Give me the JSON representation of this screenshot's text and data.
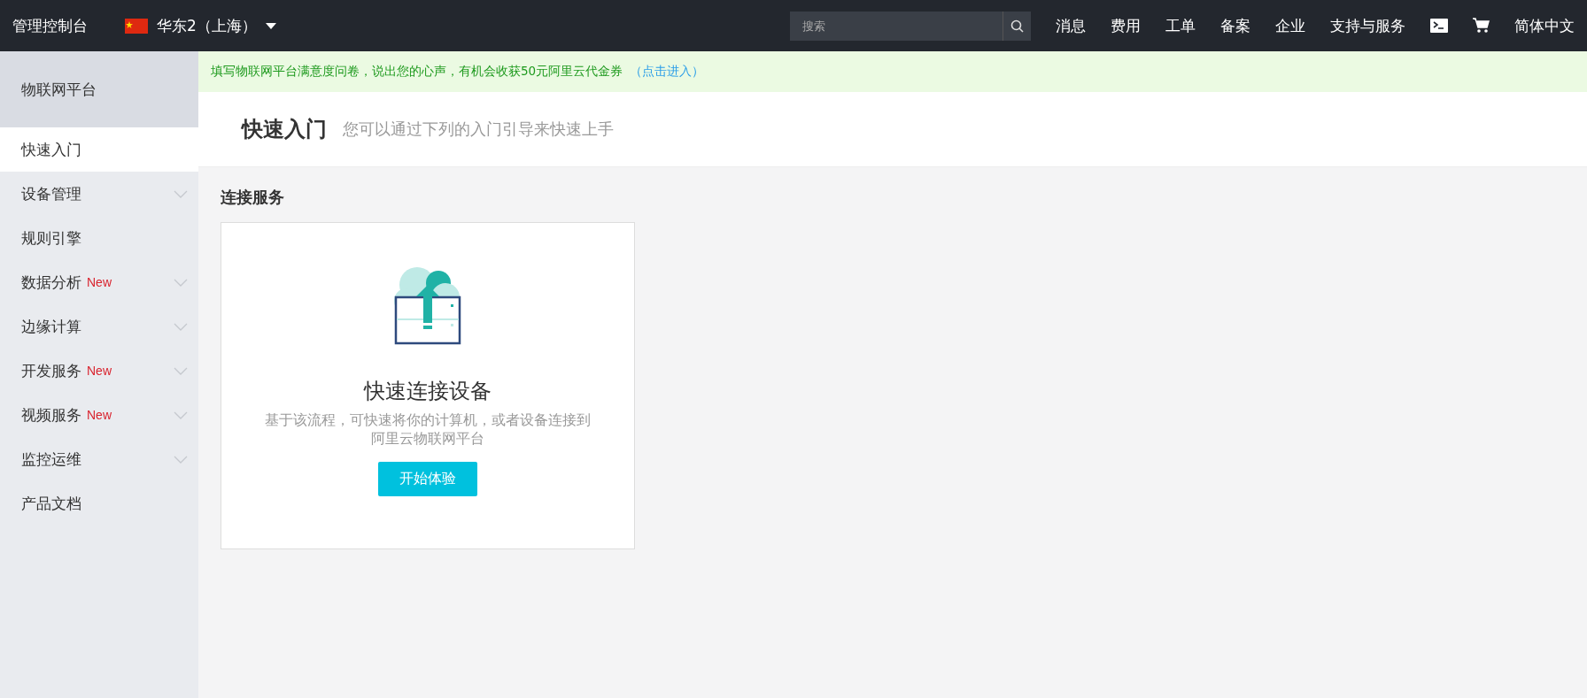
{
  "topbar": {
    "brand": "管理控制台",
    "region": "华东2（上海）",
    "search": {
      "placeholder": "搜索"
    },
    "nav": [
      "消息",
      "费用",
      "工单",
      "备案",
      "企业",
      "支持与服务"
    ],
    "language": "简体中文"
  },
  "sidebar": {
    "title": "物联网平台",
    "items": [
      {
        "label": "快速入门",
        "selected": true,
        "expandable": false
      },
      {
        "label": "设备管理",
        "selected": false,
        "expandable": true
      },
      {
        "label": "规则引擎",
        "selected": false,
        "expandable": false
      },
      {
        "label": "数据分析",
        "badge": "New",
        "selected": false,
        "expandable": true
      },
      {
        "label": "边缘计算",
        "selected": false,
        "expandable": true
      },
      {
        "label": "开发服务",
        "badge": "New",
        "selected": false,
        "expandable": true
      },
      {
        "label": "视频服务",
        "badge": "New",
        "selected": false,
        "expandable": true
      },
      {
        "label": "监控运维",
        "selected": false,
        "expandable": true
      },
      {
        "label": "产品文档",
        "selected": false,
        "expandable": false
      }
    ]
  },
  "banner": {
    "text": "填写物联网平台满意度问卷，说出您的心声，有机会收获50元阿里云代金券",
    "link": "（点击进入）"
  },
  "header": {
    "title": "快速入门",
    "subtitle": "您可以通过下列的入门引导来快速上手"
  },
  "section": {
    "title": "连接服务",
    "cards": [
      {
        "title": "快速连接设备",
        "description": "基于该流程，可快速将你的计算机，或者设备连接到阿里云物联网平台",
        "button": "开始体验"
      }
    ]
  }
}
